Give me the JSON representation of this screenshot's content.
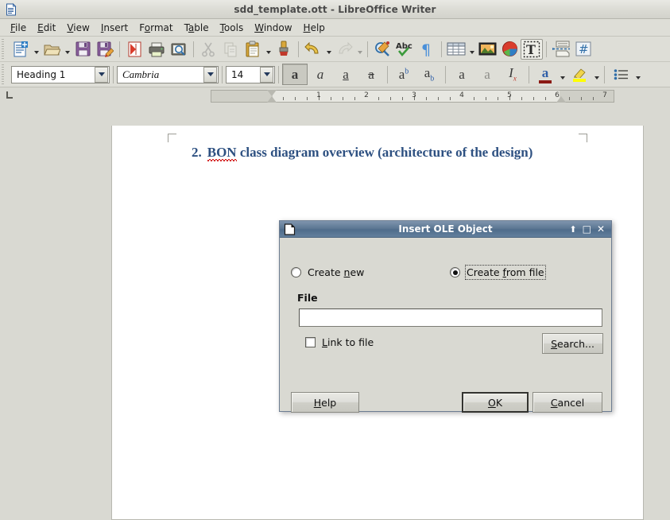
{
  "window": {
    "title": "sdd_template.ott - LibreOffice Writer",
    "app_icon": "writer-document-icon"
  },
  "menubar": {
    "items": [
      {
        "label": "File",
        "accel": "F"
      },
      {
        "label": "Edit",
        "accel": "E"
      },
      {
        "label": "View",
        "accel": "V"
      },
      {
        "label": "Insert",
        "accel": "I"
      },
      {
        "label": "Format",
        "accel": "o"
      },
      {
        "label": "Table",
        "accel": "a"
      },
      {
        "label": "Tools",
        "accel": "T"
      },
      {
        "label": "Window",
        "accel": "W"
      },
      {
        "label": "Help",
        "accel": "H"
      }
    ]
  },
  "standard_toolbar": {
    "items": [
      {
        "name": "new-document-icon",
        "title": "New"
      },
      {
        "name": "new-document-dropdown",
        "title": "New Options"
      },
      {
        "name": "open-folder-icon",
        "title": "Open"
      },
      {
        "name": "open-dropdown",
        "title": "Open Options"
      },
      {
        "name": "save-icon",
        "title": "Save"
      },
      {
        "name": "save-as-icon",
        "title": "Save As"
      },
      {
        "name": "export-pdf-icon",
        "title": "Export as PDF"
      },
      {
        "name": "print-icon",
        "title": "Print"
      },
      {
        "name": "print-preview-icon",
        "title": "Print Preview"
      },
      {
        "name": "cut-icon",
        "title": "Cut",
        "disabled": true
      },
      {
        "name": "copy-icon",
        "title": "Copy",
        "disabled": true
      },
      {
        "name": "paste-icon",
        "title": "Paste"
      },
      {
        "name": "paste-dropdown",
        "title": "Paste Special"
      },
      {
        "name": "clone-formatting-icon",
        "title": "Clone Formatting"
      },
      {
        "name": "undo-icon",
        "title": "Undo"
      },
      {
        "name": "undo-dropdown",
        "title": "Undo History"
      },
      {
        "name": "redo-icon",
        "title": "Redo",
        "disabled": true
      },
      {
        "name": "redo-dropdown",
        "title": "Redo History",
        "disabled": true
      },
      {
        "name": "find-replace-icon",
        "title": "Find and Replace"
      },
      {
        "name": "spelling-icon",
        "title": "Spelling"
      },
      {
        "name": "formatting-marks-icon",
        "title": "Formatting Marks"
      },
      {
        "name": "insert-table-icon",
        "title": "Insert Table"
      },
      {
        "name": "insert-table-dropdown",
        "title": "Table Options"
      },
      {
        "name": "insert-image-icon",
        "title": "Insert Image"
      },
      {
        "name": "insert-chart-icon",
        "title": "Insert Chart"
      },
      {
        "name": "insert-text-box-icon",
        "title": "Insert Text Box",
        "active": true
      },
      {
        "name": "page-break-icon",
        "title": "Insert Page Break"
      },
      {
        "name": "insert-field-icon",
        "title": "Insert Field"
      }
    ]
  },
  "formatting_bar": {
    "paragraph_style": "Heading 1",
    "font_name": "Cambria",
    "font_size": "14",
    "buttons": [
      {
        "name": "bold-button",
        "glyph": "a",
        "active": true
      },
      {
        "name": "italic-button",
        "glyph": "α",
        "active": false
      },
      {
        "name": "underline-button",
        "glyph": "a",
        "active": false
      },
      {
        "name": "strikethrough-button",
        "glyph": "a",
        "active": false
      },
      {
        "name": "superscript-button",
        "glyph": "ab",
        "active": false
      },
      {
        "name": "subscript-button",
        "glyph": "ab",
        "active": false
      },
      {
        "name": "uppercase-button",
        "glyph": "a",
        "active": false
      },
      {
        "name": "lowercase-button",
        "glyph": "a",
        "active": false
      },
      {
        "name": "clear-formatting-button",
        "glyph": "Ix",
        "active": false
      },
      {
        "name": "font-color-button",
        "glyph": "a",
        "color": "#8b1a14"
      },
      {
        "name": "highlighting-color-button",
        "glyph": "",
        "color": "#ffff00"
      },
      {
        "name": "unordered-list-button",
        "glyph": ""
      }
    ]
  },
  "ruler": {
    "numbers": [
      "1",
      "2",
      "3",
      "4",
      "5",
      "6",
      "7"
    ],
    "unit": "inch"
  },
  "document": {
    "heading_number": "2.",
    "heading_misspelled_word": "BON",
    "heading_rest": "class diagram overview (architecture of the design)",
    "heading_color": "#2d5081"
  },
  "dialog": {
    "title": "Insert OLE Object",
    "icon": "ole-object-icon",
    "controls": {
      "rollup": "⬆",
      "maximize": "□",
      "close": "✕"
    },
    "radio_create_new": {
      "label": "Create new",
      "accel": "n",
      "checked": false
    },
    "radio_create_from_file": {
      "label": "Create from file",
      "accel": "f",
      "checked": true
    },
    "file_group_label": "File",
    "file_input_value": "",
    "file_input_placeholder": "",
    "link_to_file": {
      "label": "Link to file",
      "accel": "L",
      "checked": false
    },
    "buttons": {
      "search": {
        "label": "Search...",
        "accel": "S"
      },
      "help": {
        "label": "Help",
        "accel": "H"
      },
      "ok": {
        "label": "OK",
        "accel": "O",
        "default": true
      },
      "cancel": {
        "label": "Cancel",
        "accel": "C"
      }
    }
  }
}
